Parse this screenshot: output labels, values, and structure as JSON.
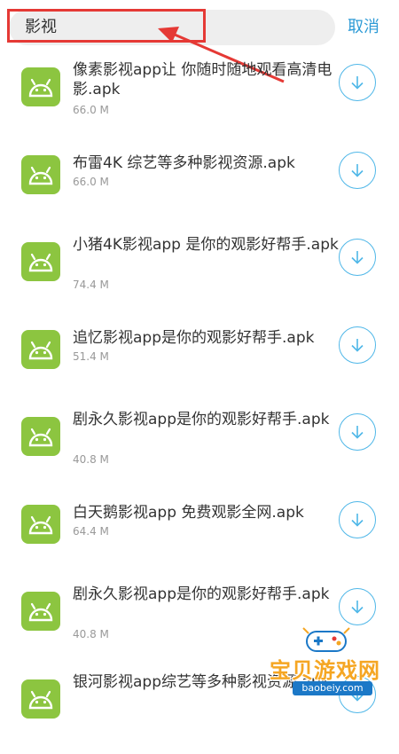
{
  "search": {
    "value": "影视",
    "cancel_label": "取消"
  },
  "files": [
    {
      "name": "像素影视app让 你随时随地观看高清电影.apk",
      "size": "66.0 M"
    },
    {
      "name": "布雷4K 综艺等多种影视资源.apk",
      "size": "66.0 M"
    },
    {
      "name": "小猪4K影视app 是你的观影好帮手.apk",
      "size": "74.4 M"
    },
    {
      "name": "追忆影视app是你的观影好帮手.apk",
      "size": "51.4 M"
    },
    {
      "name": "剧永久影视app是你的观影好帮手.apk",
      "size": "40.8 M"
    },
    {
      "name": "白天鹅影视app 免费观影全网.apk",
      "size": "64.4 M"
    },
    {
      "name": "剧永久影视app是你的观影好帮手.apk",
      "size": "40.8 M"
    },
    {
      "name": "银河影视app综艺等多种影视资源.apk",
      "size": ""
    }
  ],
  "watermark": {
    "title": "宝贝游戏网",
    "url": "baobeiy.com"
  },
  "colors": {
    "accent": "#2e9bd6",
    "icon_green": "#8cc540",
    "highlight_red": "#e53935"
  },
  "icons": {
    "app": "android-icon",
    "download": "download-arrow-icon"
  }
}
